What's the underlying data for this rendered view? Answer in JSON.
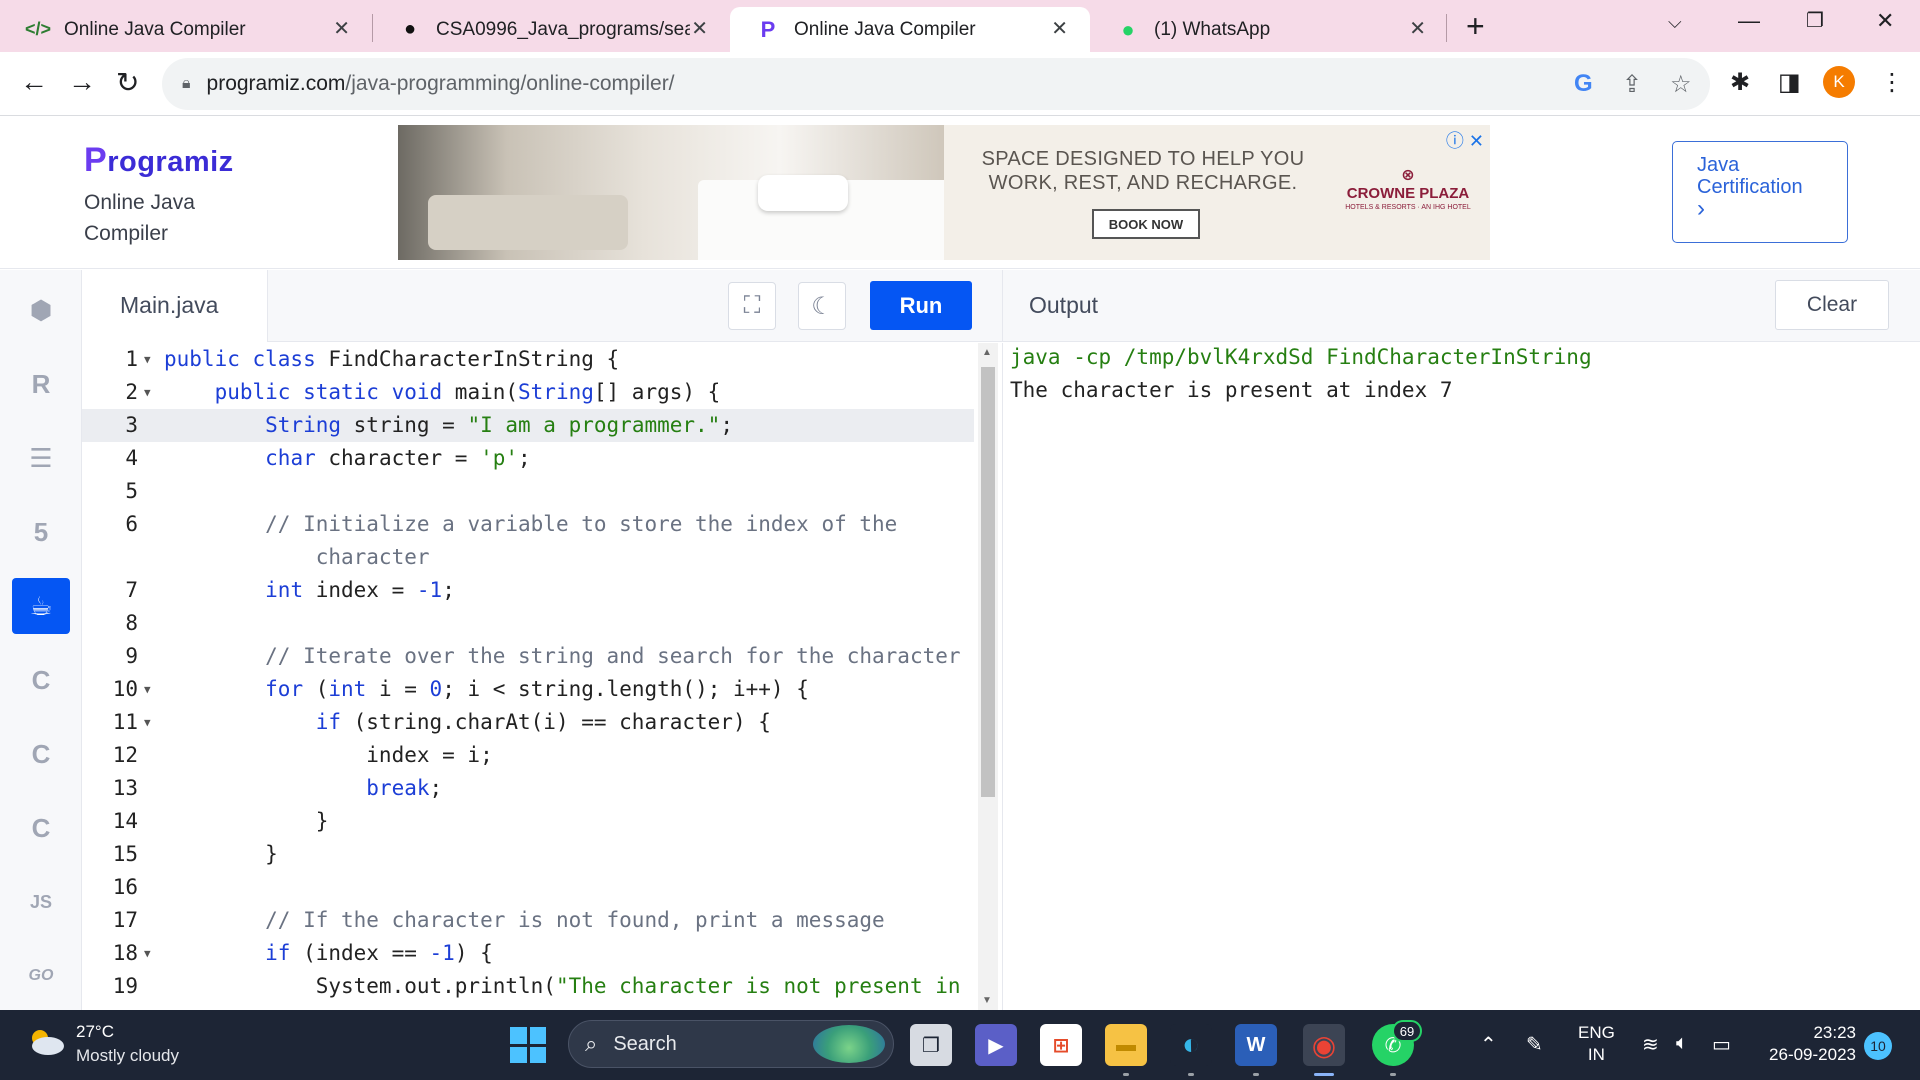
{
  "browser": {
    "tabs": [
      {
        "title": "Online Java Compiler",
        "icon": "code-favicon",
        "active": false
      },
      {
        "title": "CSA0996_Java_programs/search",
        "icon": "github-favicon",
        "active": false
      },
      {
        "title": "Online Java Compiler",
        "icon": "programiz-favicon",
        "active": true
      },
      {
        "title": "(1) WhatsApp",
        "icon": "whatsapp-favicon",
        "active": false
      }
    ],
    "url_host": "programiz.com",
    "url_path": "/java-programming/online-compiler/",
    "profile_initial": "K"
  },
  "site": {
    "logo": "rogramiz",
    "logo_p": "P",
    "subtitle": "Online Java Compiler",
    "certification_line1": "Java",
    "certification_line2": "Certification",
    "certification_arrow": "›"
  },
  "ad": {
    "tagline": "SPACE DESIGNED TO HELP YOU WORK, REST, AND RECHARGE.",
    "cta": "BOOK NOW",
    "brand": "CROWNE PLAZA",
    "brand_sub": "HOTELS & RESORTS · AN IHG HOTEL"
  },
  "editor": {
    "file_name": "Main.java",
    "run_label": "Run",
    "active_line": 3
  },
  "output": {
    "title": "Output",
    "clear_label": "Clear",
    "command": "java -cp /tmp/bvlK4rxdSd FindCharacterInString",
    "result": "The character is present at index 7"
  },
  "sidebar_languages": [
    "python-icon",
    "r-icon",
    "sql-icon",
    "html5-icon",
    "java-icon",
    "c-icon",
    "cpp-icon",
    "csharp-icon",
    "js-icon",
    "go-icon"
  ],
  "sidebar_labels": {
    "js": "JS",
    "go": "GO"
  },
  "taskbar": {
    "temperature": "27°C",
    "weather": "Mostly cloudy",
    "search_placeholder": "Search",
    "whatsapp_badge": "69",
    "lang_line1": "ENG",
    "lang_line2": "IN",
    "time": "23:23",
    "date": "26-09-2023",
    "notifications": "10"
  },
  "colors": {
    "accent": "#0556f3",
    "keyword": "#1c3ed6",
    "string": "#267f12",
    "comment": "#6a7282",
    "tabbar": "#f6dbe8"
  }
}
